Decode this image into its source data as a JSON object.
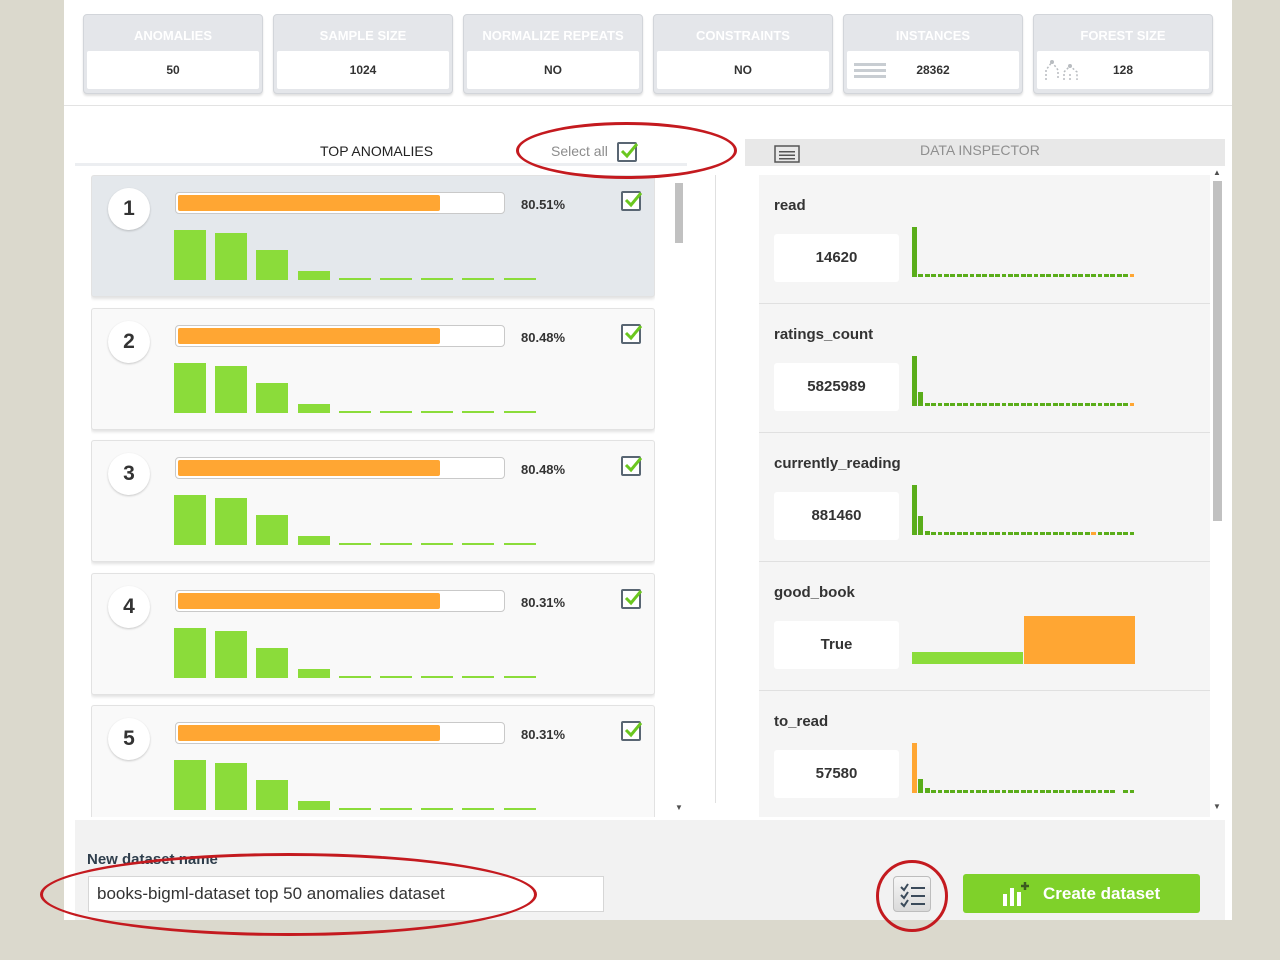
{
  "stats": [
    {
      "title": "ANOMALIES",
      "value": "50",
      "icon": ""
    },
    {
      "title": "SAMPLE SIZE",
      "value": "1024",
      "icon": ""
    },
    {
      "title": "NORMALIZE REPEATS",
      "value": "NO",
      "icon": ""
    },
    {
      "title": "CONSTRAINTS",
      "value": "NO",
      "icon": ""
    },
    {
      "title": "INSTANCES",
      "value": "28362",
      "icon": "rows-icon"
    },
    {
      "title": "FOREST SIZE",
      "value": "128",
      "icon": "forest-icon"
    }
  ],
  "top_anomalies": {
    "title": "TOP ANOMALIES",
    "select_all_label": "Select all",
    "select_all_checked": true,
    "items": [
      {
        "rank": "1",
        "score": "80.51%",
        "score_fraction": 0.8051,
        "checked": true,
        "selected": true,
        "bars": [
          1.0,
          0.94,
          0.6,
          0.18,
          0.02,
          0.02,
          0.02,
          0.02,
          0.02
        ]
      },
      {
        "rank": "2",
        "score": "80.48%",
        "score_fraction": 0.8048,
        "checked": true,
        "selected": false,
        "bars": [
          1.0,
          0.94,
          0.6,
          0.18,
          0.02,
          0.02,
          0.02,
          0.02,
          0.02
        ]
      },
      {
        "rank": "3",
        "score": "80.48%",
        "score_fraction": 0.8048,
        "checked": true,
        "selected": false,
        "bars": [
          1.0,
          0.94,
          0.6,
          0.18,
          0.02,
          0.02,
          0.02,
          0.02,
          0.02
        ]
      },
      {
        "rank": "4",
        "score": "80.31%",
        "score_fraction": 0.8031,
        "checked": true,
        "selected": false,
        "bars": [
          1.0,
          0.94,
          0.6,
          0.18,
          0.02,
          0.02,
          0.02,
          0.02,
          0.02
        ]
      },
      {
        "rank": "5",
        "score": "80.31%",
        "score_fraction": 0.8031,
        "checked": true,
        "selected": false,
        "bars": [
          1.0,
          0.94,
          0.6,
          0.18,
          0.02,
          0.02,
          0.02,
          0.02,
          0.02
        ]
      }
    ],
    "colors": {
      "score": "#ffa633",
      "bars": "#8bdc3a"
    }
  },
  "data_inspector": {
    "title": "DATA INSPECTOR",
    "fields": [
      {
        "name": "read",
        "value": "14620",
        "type": "numeric",
        "highlight_index": 34,
        "bins": [
          1.0,
          0.1,
          0.08,
          0.08,
          0.08,
          0.08,
          0.08,
          0.08,
          0.08,
          0.08,
          0.08,
          0.08,
          0.08,
          0.08,
          0.08,
          0.08,
          0.08,
          0.08,
          0.08,
          0.08,
          0.08,
          0.08,
          0.08,
          0.08,
          0.08,
          0.08,
          0.08,
          0.08,
          0.08,
          0.08,
          0.08,
          0.08,
          0.08,
          0.08,
          0.08
        ]
      },
      {
        "name": "ratings_count",
        "value": "5825989",
        "type": "numeric",
        "highlight_index": 34,
        "bins": [
          1.0,
          0.28,
          0.12,
          0.08,
          0.08,
          0.08,
          0.08,
          0.08,
          0.08,
          0.08,
          0.08,
          0.08,
          0.08,
          0.08,
          0.08,
          0.08,
          0.08,
          0.08,
          0.08,
          0.08,
          0.08,
          0.08,
          0.08,
          0.08,
          0.08,
          0.08,
          0.08,
          0.08,
          0.08,
          0.08,
          0.08,
          0.08,
          0.08,
          0.08,
          0.08
        ]
      },
      {
        "name": "currently_reading",
        "value": "881460",
        "type": "numeric",
        "highlight_index": 28,
        "bins": [
          1.0,
          0.38,
          0.16,
          0.08,
          0.08,
          0.08,
          0.08,
          0.08,
          0.08,
          0.08,
          0.08,
          0.08,
          0.08,
          0.08,
          0.08,
          0.08,
          0.08,
          0.08,
          0.08,
          0.08,
          0.08,
          0.08,
          0.08,
          0.08,
          0.08,
          0.08,
          0.08,
          0.08,
          0.08,
          0.08,
          0.08,
          0.08,
          0.08,
          0.08,
          0.08
        ]
      },
      {
        "name": "good_book",
        "value": "True",
        "type": "categorical",
        "highlight_index": 1,
        "bins": [
          0.25,
          1.0
        ]
      },
      {
        "name": "to_read",
        "value": "57580",
        "type": "numeric",
        "highlight_index": 0,
        "bins": [
          1.0,
          0.28,
          0.18,
          0.1,
          0.1,
          0.1,
          0.1,
          0.1,
          0.1,
          0.1,
          0.1,
          0.1,
          0.1,
          0.1,
          0.1,
          0.1,
          0.1,
          0.1,
          0.1,
          0.1,
          0.1,
          0.1,
          0.1,
          0.1,
          0.1,
          0.1,
          0.1,
          0.1,
          0.1,
          0.1,
          0.1,
          0.1,
          0.0,
          0.1,
          0.1
        ]
      }
    ],
    "colors": {
      "bins": "#5aad1a",
      "highlight": "#ffa633",
      "categorical": "#8bdc3a"
    }
  },
  "new_dataset": {
    "label": "New dataset name",
    "value": "books-bigml-dataset top 50 anomalies dataset",
    "create_label": "Create dataset"
  }
}
